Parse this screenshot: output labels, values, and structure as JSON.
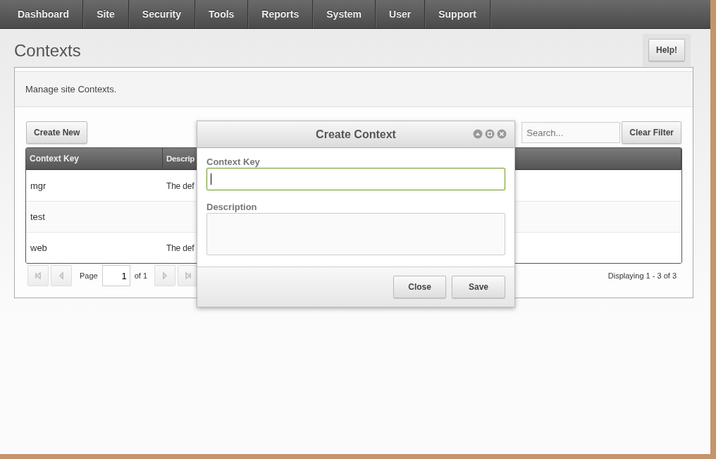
{
  "nav": {
    "items": [
      {
        "label": "Dashboard"
      },
      {
        "label": "Site"
      },
      {
        "label": "Security"
      },
      {
        "label": "Tools"
      },
      {
        "label": "Reports"
      },
      {
        "label": "System"
      },
      {
        "label": "User"
      },
      {
        "label": "Support"
      }
    ]
  },
  "page": {
    "title": "Contexts",
    "help_button": "Help!",
    "description": "Manage site Contexts."
  },
  "toolbar": {
    "create_button": "Create New",
    "search": {
      "placeholder": "Search..."
    },
    "clear_button": "Clear Filter"
  },
  "table": {
    "columns": [
      "Context Key",
      "Descrip"
    ],
    "rows": [
      {
        "key": "mgr",
        "description": "The def"
      },
      {
        "key": "test"
      },
      {
        "key": "web",
        "description": "The def"
      }
    ]
  },
  "pagination": {
    "page_label": "Page",
    "page_value": "1",
    "of_label": "of 1",
    "status": "Displaying 1 - 3 of 3"
  },
  "dialog": {
    "title": "Create Context",
    "fields": [
      {
        "label": "Context Key",
        "kind": "input",
        "focused": true
      },
      {
        "label": "Description",
        "kind": "textarea",
        "focused": false
      }
    ],
    "buttons": [
      "Close",
      "Save"
    ]
  }
}
